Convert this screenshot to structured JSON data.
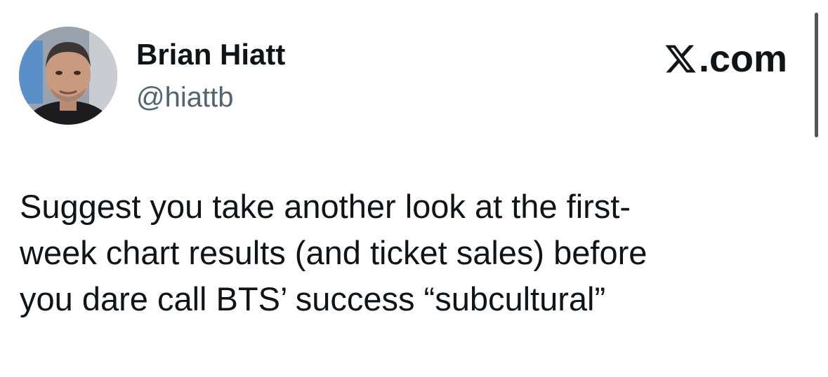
{
  "author": {
    "display_name": "Brian Hiatt",
    "handle": "@hiattb",
    "avatar_icon": "profile-photo"
  },
  "brand": {
    "logo_icon": "x-logo-icon",
    "suffix": ".com"
  },
  "tweet": {
    "lines": [
      "Suggest you take another look at the first-",
      "week chart results (and ticket sales) before",
      "you dare call BTS’ success “subcultural”"
    ]
  },
  "colors": {
    "text": "#0f1419",
    "secondary": "#536471",
    "background": "#ffffff"
  }
}
